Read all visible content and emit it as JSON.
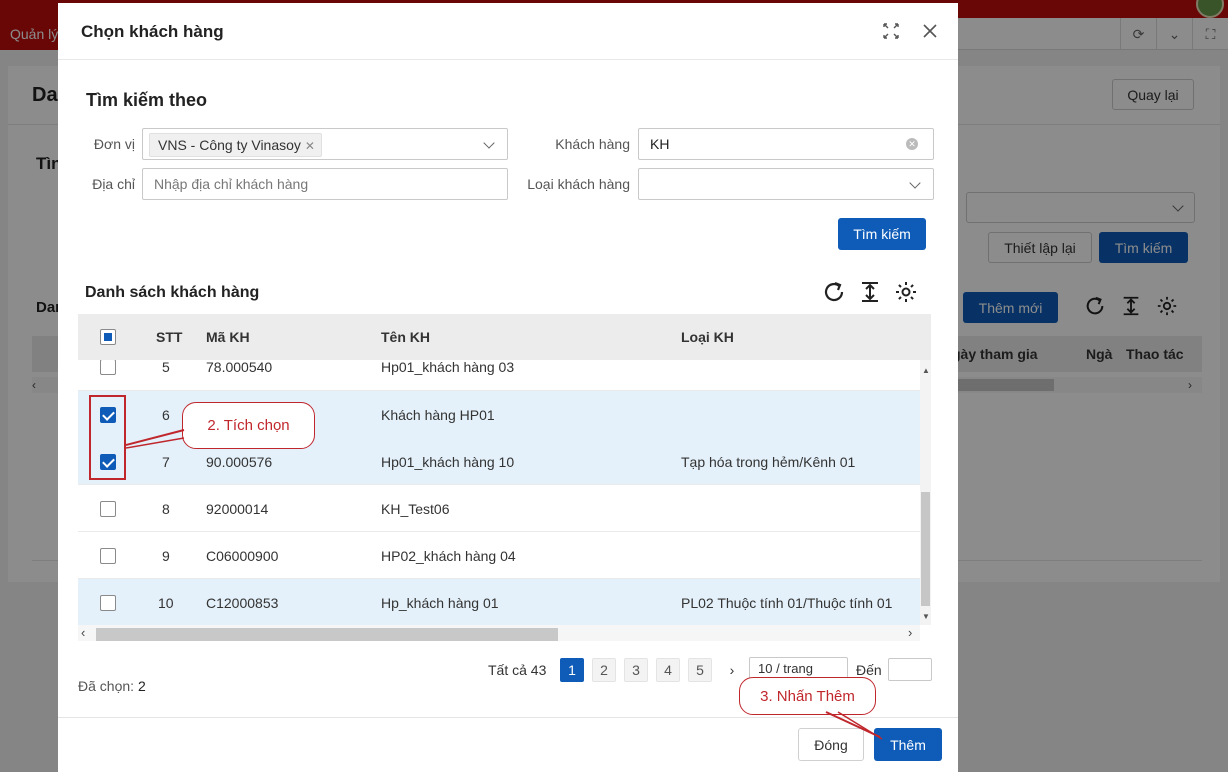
{
  "background": {
    "tab_label": "Quản lý",
    "page_title": "Da",
    "back_button": "Quay lại",
    "search_section": "Tìn",
    "reset_button": "Thiết lập lại",
    "search_button": "Tìm kiếm",
    "list_section": "Dan",
    "add_button": "Thêm mới",
    "columns": [
      "gày tham gia",
      "Ngà",
      "Thao tác"
    ]
  },
  "modal": {
    "title": "Chọn khách hàng",
    "search": {
      "title": "Tìm kiếm theo",
      "unit_label": "Đơn vị",
      "unit_tag": "VNS - Công ty Vinasoy",
      "customer_label": "Khách hàng",
      "customer_value": "KH",
      "address_label": "Địa chỉ",
      "address_placeholder": "Nhập địa chỉ khách hàng",
      "type_label": "Loại khách hàng",
      "search_button": "Tìm kiếm"
    },
    "list": {
      "title": "Danh sách khách hàng",
      "columns": {
        "stt": "STT",
        "code": "Mã KH",
        "name": "Tên KH",
        "type": "Loại KH"
      },
      "rows": [
        {
          "stt": "5",
          "code": "78.000540",
          "name": "Hp01_khách hàng 03",
          "type": "",
          "checked": false
        },
        {
          "stt": "6",
          "code": "",
          "name": "Khách hàng HP01",
          "type": "",
          "checked": true
        },
        {
          "stt": "7",
          "code": "90.000576",
          "name": "Hp01_khách hàng 10",
          "type": "Tạp hóa trong hẻm/Kênh 01",
          "checked": true
        },
        {
          "stt": "8",
          "code": "92000014",
          "name": "KH_Test06",
          "type": "",
          "checked": false
        },
        {
          "stt": "9",
          "code": "C06000900",
          "name": "HP02_khách hàng 04",
          "type": "",
          "checked": false
        },
        {
          "stt": "10",
          "code": "C12000853",
          "name": "Hp_khách hàng 01",
          "type": "PL02 Thuộc tính 01/Thuộc tính 01",
          "checked": false
        }
      ]
    },
    "selected_label": "Đã chọn:",
    "selected_count": "2",
    "pagination": {
      "total": "Tất cả 43",
      "pages": [
        "1",
        "2",
        "3",
        "4",
        "5"
      ],
      "current": "1",
      "page_size": "10 / trang",
      "goto_label": "Đến"
    },
    "close_button": "Đóng",
    "add_button": "Thêm"
  },
  "annotations": {
    "step2": "2. Tích chọn",
    "step3": "3. Nhấn Thêm"
  },
  "colors": {
    "primary": "#0f5cb8",
    "brand_red": "#c00d0d",
    "annotation": "#c0272d",
    "selected_row": "#e4f1fa"
  }
}
